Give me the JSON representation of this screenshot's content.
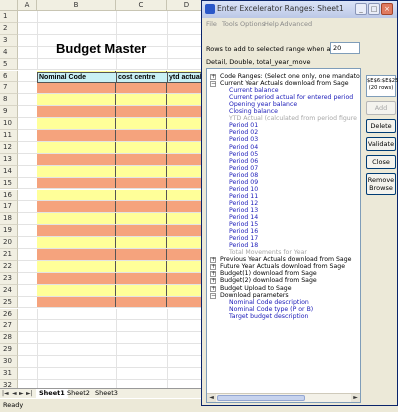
{
  "spreadsheet": {
    "columns": [
      "A",
      "B",
      "C",
      "D"
    ],
    "rows": [
      "1",
      "2",
      "3",
      "4",
      "5",
      "6",
      "7",
      "8",
      "9",
      "10",
      "11",
      "12",
      "13",
      "14",
      "15",
      "16",
      "17",
      "18",
      "19",
      "20",
      "21",
      "22",
      "23",
      "24",
      "25",
      "26",
      "27",
      "28",
      "29",
      "30",
      "31",
      "32"
    ],
    "title": "Budget Master",
    "headers": [
      "Nominal Code",
      "cost centre",
      "ytd actuals"
    ],
    "colors": {
      "yellow_row": "#ffff99",
      "pink_row": "#f5a37d",
      "header_fill": "#c9f0f5"
    }
  },
  "sheet_tabs": {
    "nav": [
      "|◄",
      "◄",
      "►",
      "►|"
    ],
    "tabs": [
      "Sheet1",
      "Sheet2",
      "Sheet3"
    ]
  },
  "status": {
    "text": "Ready"
  },
  "dialog": {
    "title": "Enter Excelerator Ranges: Sheet1",
    "menu": [
      "File",
      "Tools",
      "Options",
      "Help",
      "Advanced"
    ],
    "rows_label": "Rows to add to selected range when adding",
    "rows_value": "20",
    "detail": "Detail, Double, total_year_move",
    "range_display": [
      "$E$6:$E$25",
      "(20 rows)"
    ],
    "buttons": {
      "add": "Add",
      "delete": "Delete",
      "validate": "Validate",
      "close": "Close",
      "remove_browse": [
        "Remove",
        "Browse"
      ]
    },
    "tree": [
      {
        "text": "Code Ranges: (Select one only, one mandatory)",
        "color": "black",
        "expander": "+",
        "level": 0
      },
      {
        "text": "Current Year Actuals download from Sage",
        "color": "black",
        "expander": "−",
        "level": 0
      },
      {
        "text": "Current balance",
        "color": "blue",
        "level": 1
      },
      {
        "text": "Current period actual for entered period",
        "color": "blue",
        "level": 1
      },
      {
        "text": "Opening year balance",
        "color": "blue",
        "level": 1
      },
      {
        "text": "Closing balance",
        "color": "blue",
        "level": 1
      },
      {
        "text": "YTD Actual (calculated from period figure",
        "color": "grey",
        "level": 1
      },
      {
        "text": "Period 01",
        "color": "blue",
        "level": 1
      },
      {
        "text": "Period 02",
        "color": "blue",
        "level": 1
      },
      {
        "text": "Period 03",
        "color": "blue",
        "level": 1
      },
      {
        "text": "Period 04",
        "color": "blue",
        "level": 1
      },
      {
        "text": "Period 05",
        "color": "blue",
        "level": 1
      },
      {
        "text": "Period 06",
        "color": "blue",
        "level": 1
      },
      {
        "text": "Period 07",
        "color": "blue",
        "level": 1
      },
      {
        "text": "Period 08",
        "color": "blue",
        "level": 1
      },
      {
        "text": "Period 09",
        "color": "blue",
        "level": 1
      },
      {
        "text": "Period 10",
        "color": "blue",
        "level": 1
      },
      {
        "text": "Period 11",
        "color": "blue",
        "level": 1
      },
      {
        "text": "Period 12",
        "color": "blue",
        "level": 1
      },
      {
        "text": "Period 13",
        "color": "blue",
        "level": 1
      },
      {
        "text": "Period 14",
        "color": "blue",
        "level": 1
      },
      {
        "text": "Period 15",
        "color": "blue",
        "level": 1
      },
      {
        "text": "Period 16",
        "color": "blue",
        "level": 1
      },
      {
        "text": "Period 17",
        "color": "blue",
        "level": 1
      },
      {
        "text": "Period 18",
        "color": "blue",
        "level": 1
      },
      {
        "text": "Total Movements for Year",
        "color": "grey",
        "level": 1
      },
      {
        "text": "Previous Year Actuals download from Sage",
        "color": "black",
        "expander": "+",
        "level": 0
      },
      {
        "text": "Future Year Actuals download from Sage",
        "color": "black",
        "expander": "+",
        "level": 0
      },
      {
        "text": "Budget(1) download from Sage",
        "color": "black",
        "expander": "+",
        "level": 0
      },
      {
        "text": "Budget(2) download from Sage",
        "color": "black",
        "expander": "+",
        "level": 0
      },
      {
        "text": "Budget Upload to Sage",
        "color": "black",
        "expander": "+",
        "level": 0
      },
      {
        "text": "Download parameters",
        "color": "black",
        "expander": "−",
        "level": 0
      },
      {
        "text": "Nominal Code description",
        "color": "blue",
        "level": 1
      },
      {
        "text": "Nominal Code type (P or B)",
        "color": "blue",
        "level": 1
      },
      {
        "text": "Target budget description",
        "color": "blue",
        "level": 1
      }
    ]
  }
}
